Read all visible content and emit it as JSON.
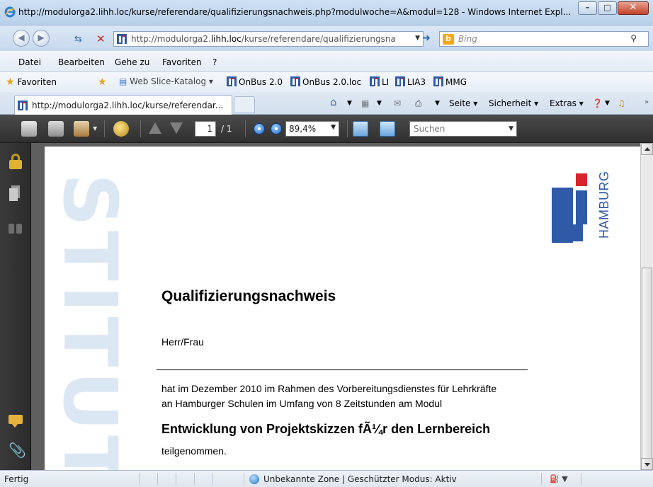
{
  "window": {
    "title": "http://modulorga2.lihh.loc/kurse/referendare/qualifizierungsnachweis.php?modulwoche=A&modul=128 - Windows Internet Expl...",
    "minimize_glyph": "–",
    "maximize_glyph": "□",
    "close_glyph": "✕"
  },
  "address": {
    "url_prefix": "http://modulorga2.",
    "url_host": "lihh.loc",
    "url_rest": "/kurse/referendare/qualifizierungsna",
    "search_engine": "Bing"
  },
  "menu": {
    "items": [
      "Datei",
      "Bearbeiten",
      "Gehe zu",
      "Favoriten",
      "?"
    ]
  },
  "favorites": {
    "label": "Favoriten",
    "items": [
      {
        "label": "Web Slice-Katalog ▾"
      },
      {
        "label": "OnBus 2.0"
      },
      {
        "label": "OnBus 2.0.loc"
      },
      {
        "label": "LI"
      },
      {
        "label": "LIA3"
      },
      {
        "label": "MMG"
      }
    ]
  },
  "tabs": {
    "active_label": "http://modulorga2.lihh.loc/kurse/referendar..."
  },
  "commandbar": {
    "seite": "Seite ▾",
    "sicherheit": "Sicherheit ▾",
    "extras": "Extras ▾"
  },
  "pdf_toolbar": {
    "page_current": "1",
    "page_total": "/ 1",
    "zoom": "89,4%",
    "search_placeholder": "Suchen"
  },
  "document": {
    "watermark": "STITUT",
    "logo_text": "HAMBURG",
    "title": "Qualifizierungsnachweis",
    "salutation": "Herr/Frau",
    "line1": "hat im Dezember 2010 im Rahmen des Vorbereitungsdienstes für Lehrkräfte",
    "line2": "an Hamburger Schulen im Umfang von 8 Zeitstunden am Modul",
    "module_title": "Entwicklung von Projektskizzen fÃ¼r den Lernbereich",
    "participation": "teilgenommen."
  },
  "status": {
    "text": "Fertig",
    "zone": "Unbekannte Zone | Geschützter Modus: Aktiv"
  },
  "colors": {
    "li_blue": "#2f5aa8",
    "li_red": "#d6252c",
    "watermark": "#dce7f4"
  }
}
